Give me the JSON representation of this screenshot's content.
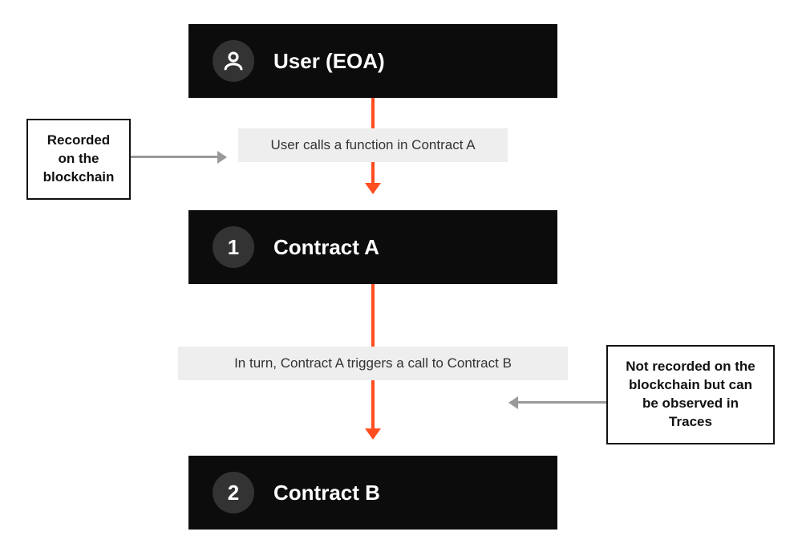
{
  "blocks": {
    "user": {
      "title": "User (EOA)"
    },
    "contractA": {
      "num": "1",
      "title": "Contract A"
    },
    "contractB": {
      "num": "2",
      "title": "Contract B"
    }
  },
  "notes": {
    "call1": "User calls a function in Contract A",
    "call2": "In turn, Contract A triggers a call to Contract B"
  },
  "callouts": {
    "recorded": "Recorded on the blockchain",
    "notRecorded": "Not recorded on the blockchain but can be observed in Traces"
  },
  "colors": {
    "block": "#0c0c0c",
    "circle": "#333333",
    "note": "#eeeeee",
    "arrow": "#ff4d1f",
    "grayArrow": "#999999"
  }
}
